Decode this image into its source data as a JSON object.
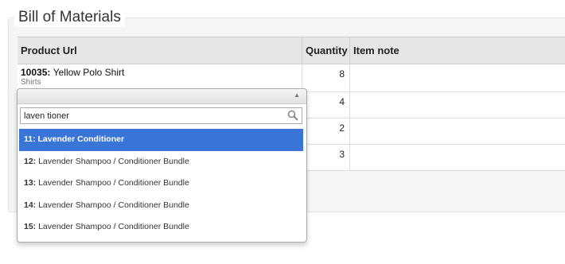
{
  "section": {
    "title": "Bill of Materials"
  },
  "table": {
    "headers": [
      "Product Url",
      "Quantity",
      "Item note"
    ],
    "rows": [
      {
        "product_id": "10035:",
        "product_name": "Yellow Polo Shirt",
        "category": "Shirts",
        "quantity": "8",
        "note": ""
      },
      {
        "product_id": "",
        "product_name": "",
        "category": "",
        "quantity": "4",
        "note": ""
      },
      {
        "product_id": "",
        "product_name": "",
        "category": "",
        "quantity": "2",
        "note": ""
      },
      {
        "product_id": "",
        "product_name": "",
        "category": "",
        "quantity": "3",
        "note": ""
      }
    ]
  },
  "dropdown": {
    "search_value": "laven tioner",
    "search_icon": "magnifier",
    "results": [
      {
        "id": "11:",
        "name": "Lavender Conditioner",
        "selected": true
      },
      {
        "id": "12:",
        "name": "Lavender Shampoo / Conditioner Bundle",
        "selected": false
      },
      {
        "id": "13:",
        "name": "Lavender Shampoo / Conditioner Bundle",
        "selected": false
      },
      {
        "id": "14:",
        "name": "Lavender Shampoo / Conditioner Bundle",
        "selected": false
      },
      {
        "id": "15:",
        "name": "Lavender Shampoo / Conditioner Bundle",
        "selected": false
      }
    ]
  },
  "colors": {
    "selected_bg": "#3875d7",
    "header_bg": "#e6e6e6"
  }
}
